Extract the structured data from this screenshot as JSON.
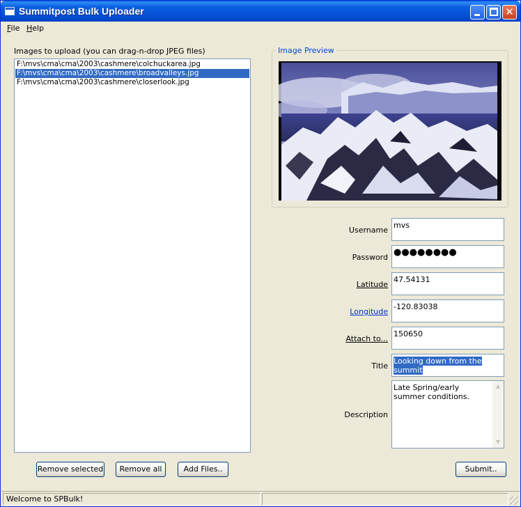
{
  "window": {
    "title": "Summitpost Bulk Uploader"
  },
  "menu": {
    "items": [
      "File",
      "Help"
    ]
  },
  "upload": {
    "label": "Images to upload (you can drag-n-drop JPEG files)",
    "files": [
      "F:\\mvs\\cma\\cma\\2003\\cashmere\\colchuckarea.jpg",
      "F:\\mvs\\cma\\cma\\2003\\cashmere\\broadvalleys.jpg",
      "F:\\mvs\\cma\\cma\\2003\\cashmere\\closerlook.jpg"
    ],
    "selected_index": 1,
    "buttons": {
      "remove_selected": "Remove selected",
      "remove_all": "Remove all",
      "add_files": "Add Files.."
    }
  },
  "preview": {
    "label": "Image Preview"
  },
  "form": {
    "username_label": "Username",
    "username": "mvs",
    "password_label": "Password",
    "password": "●●●●●●●●",
    "latitude_label": "Latitude",
    "latitude": "47.54131",
    "longitude_label": "Longitude",
    "longitude": "-120.83038",
    "attach_label": "Attach to...",
    "attach": "150650",
    "title_label": "Title",
    "title": "Looking down from the summit",
    "description_label": "Description",
    "description": "Late Spring/early summer conditions.",
    "submit": "Submit.."
  },
  "status": {
    "message": "Welcome to SPBulk!",
    "secondary": ""
  },
  "colors": {
    "titlebar": "#0550d6",
    "selection": "#316ac5",
    "link": "#0033cc",
    "window_bg": "#ece9d8"
  }
}
